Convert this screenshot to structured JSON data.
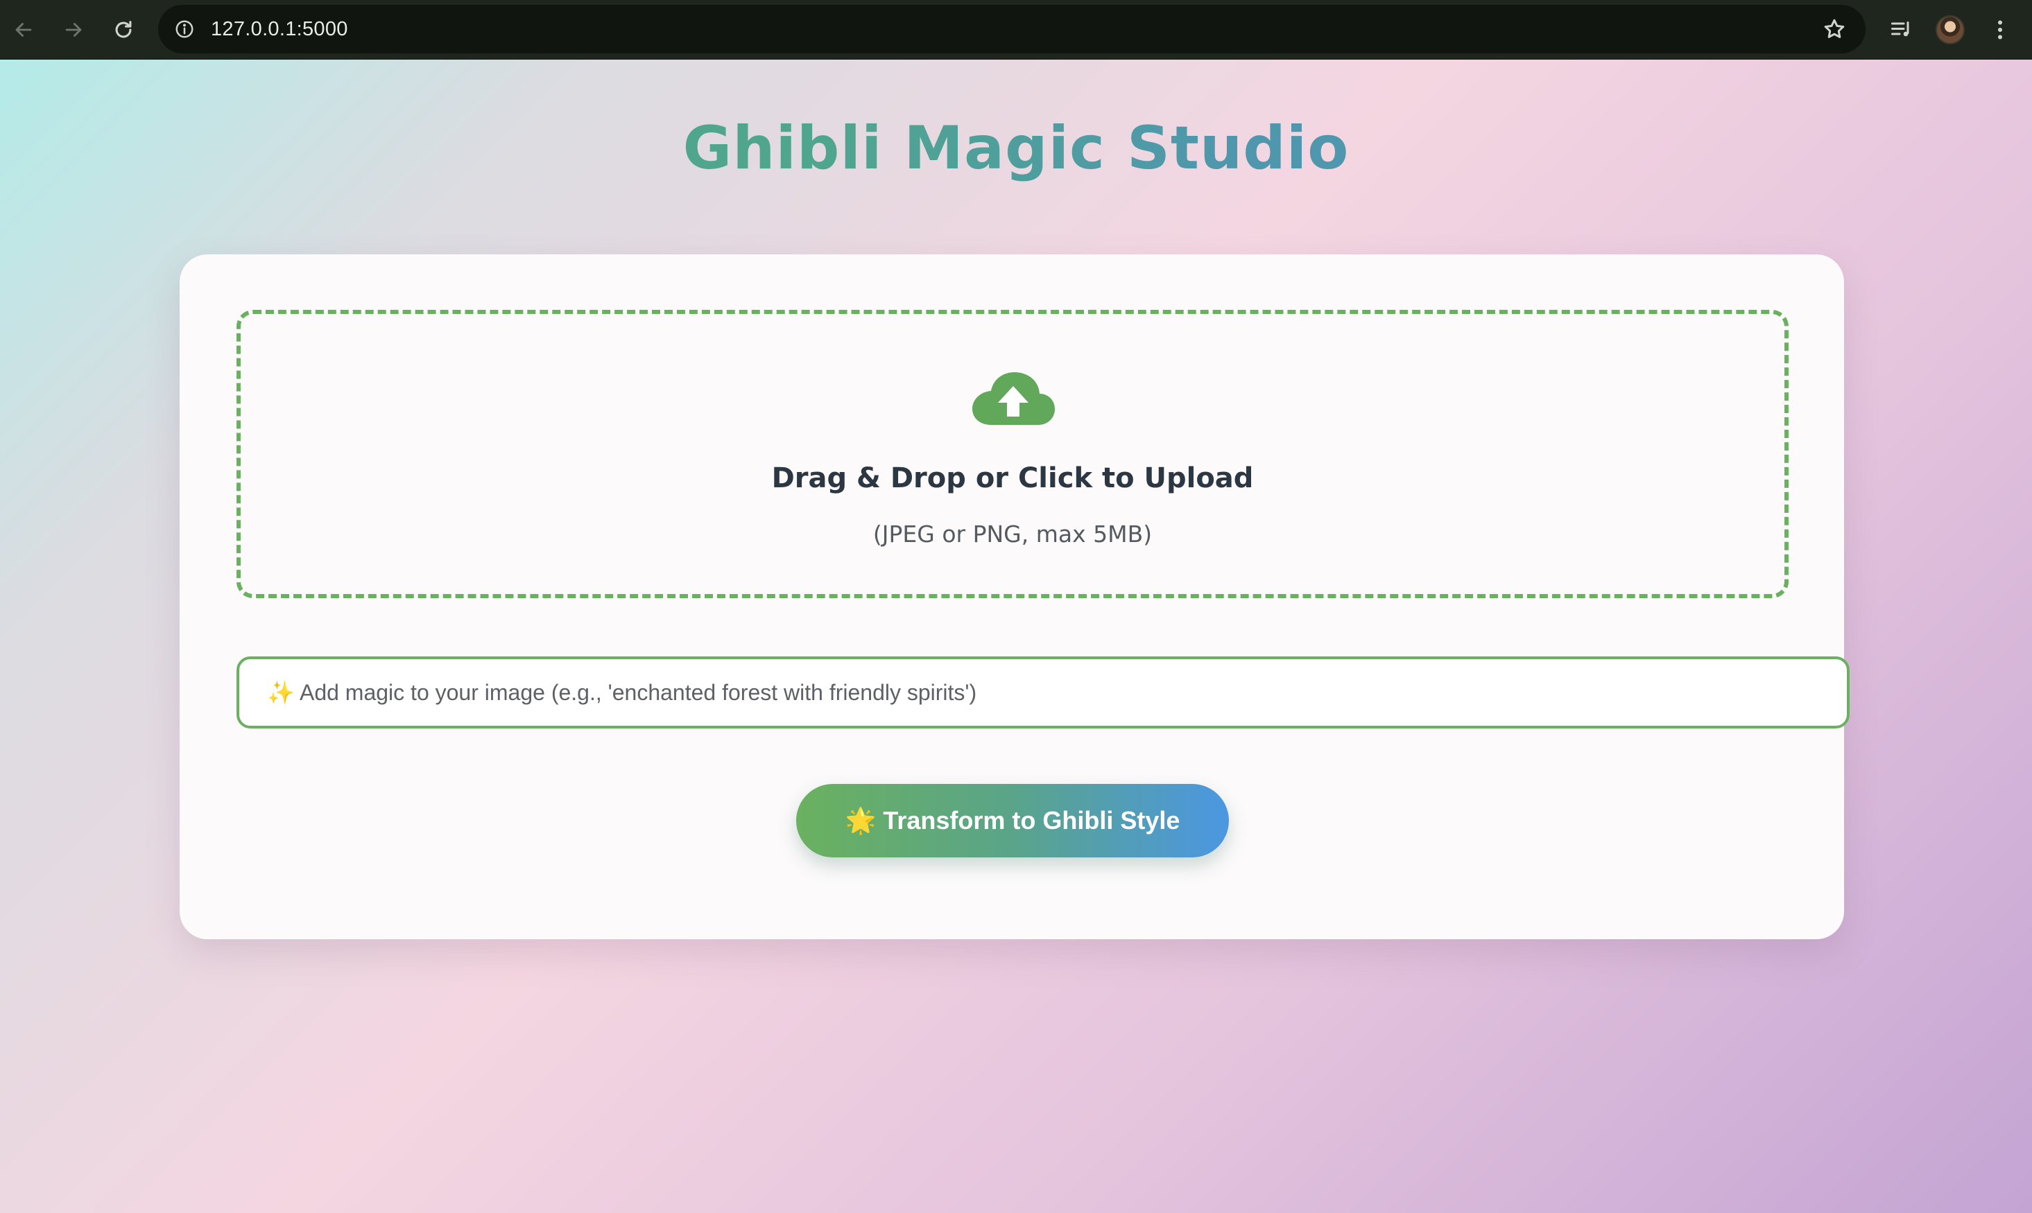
{
  "browser": {
    "url": "127.0.0.1:5000",
    "icons": {
      "back": "arrow-left-icon",
      "forward": "arrow-right-icon",
      "reload": "reload-icon",
      "info": "info-icon",
      "bookmark": "star-icon",
      "media": "media-controls-icon",
      "profile": "avatar",
      "menu": "kebab-menu-icon"
    }
  },
  "app": {
    "title": "Ghibli Magic Studio"
  },
  "upload": {
    "icon": "cloud-upload-icon",
    "heading": "Drag & Drop or Click to Upload",
    "subtext": "(JPEG or PNG, max 5MB)"
  },
  "prompt": {
    "value": "",
    "placeholder": "✨ Add magic to your image (e.g., 'enchanted forest with friendly spirits')"
  },
  "transform_button": {
    "label": "🌟 Transform to Ghibli Style"
  },
  "colors": {
    "accent_green": "#6ab15f",
    "accent_blue": "#4b97e2",
    "title_teal": "#4fa68d"
  }
}
